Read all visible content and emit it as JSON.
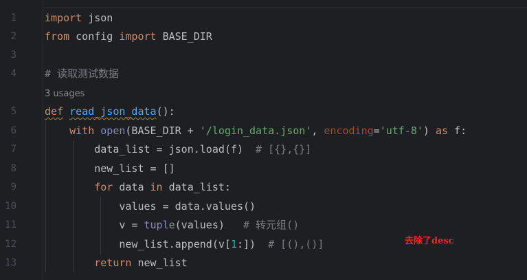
{
  "editor": {
    "lines": [
      {
        "num": "1",
        "tokens": [
          [
            "kw",
            "import"
          ],
          [
            "",
            " json"
          ]
        ]
      },
      {
        "num": "2",
        "tokens": [
          [
            "kw",
            "from"
          ],
          [
            "",
            " config "
          ],
          [
            "kw",
            "import"
          ],
          [
            "",
            " BASE_DIR"
          ]
        ]
      },
      {
        "num": "3",
        "tokens": []
      },
      {
        "num": "4",
        "tokens": [
          [
            "cmt",
            "# 读取测试数据"
          ]
        ]
      },
      {
        "num": "",
        "usages": "3 usages"
      },
      {
        "num": "5",
        "tokens": [
          [
            "kw def-underline",
            "def"
          ],
          [
            "",
            " "
          ],
          [
            "fn def-underline",
            "read_json_data"
          ],
          [
            "",
            "():"
          ]
        ]
      },
      {
        "num": "6",
        "tokens": [
          [
            "",
            "    "
          ],
          [
            "kw",
            "with"
          ],
          [
            "",
            " "
          ],
          [
            "builtin",
            "open"
          ],
          [
            "",
            "(BASE_DIR + "
          ],
          [
            "str",
            "'/login_data.json'"
          ],
          [
            "",
            ", "
          ],
          [
            "param",
            "encoding"
          ],
          [
            "",
            "="
          ],
          [
            "str",
            "'utf-8'"
          ],
          [
            "",
            ") "
          ],
          [
            "kw",
            "as"
          ],
          [
            "",
            " f:"
          ]
        ]
      },
      {
        "num": "7",
        "tokens": [
          [
            "",
            "        data_list = json.load(f)  "
          ],
          [
            "cmt",
            "# [{},{}]"
          ]
        ]
      },
      {
        "num": "8",
        "tokens": [
          [
            "",
            "        new_list = []"
          ]
        ]
      },
      {
        "num": "9",
        "tokens": [
          [
            "",
            "        "
          ],
          [
            "kw",
            "for"
          ],
          [
            "",
            " data "
          ],
          [
            "kw",
            "in"
          ],
          [
            "",
            " data_list:"
          ]
        ]
      },
      {
        "num": "10",
        "tokens": [
          [
            "",
            "            values = data.values()"
          ]
        ]
      },
      {
        "num": "11",
        "tokens": [
          [
            "",
            "            v = "
          ],
          [
            "builtin",
            "tuple"
          ],
          [
            "",
            "(values)   "
          ],
          [
            "cmt",
            "# 转元组()"
          ]
        ]
      },
      {
        "num": "12",
        "tokens": [
          [
            "",
            "            new_list.append(v["
          ],
          [
            "num",
            "1"
          ],
          [
            "",
            ":])  "
          ],
          [
            "cmt",
            "# [(),()]"
          ]
        ]
      },
      {
        "num": "13",
        "tokens": [
          [
            "",
            "        "
          ],
          [
            "kw",
            "return"
          ],
          [
            "",
            " new_list"
          ]
        ]
      }
    ],
    "annotation": "去除了desc"
  },
  "colors": {
    "background": "#1e1f22",
    "keyword": "#cf8e6d",
    "function": "#56a8f5",
    "builtin": "#8888c6",
    "string": "#6aab73",
    "param": "#aa4926",
    "number": "#2aacb8",
    "comment": "#7a7e85",
    "annotation": "#ff2222"
  }
}
